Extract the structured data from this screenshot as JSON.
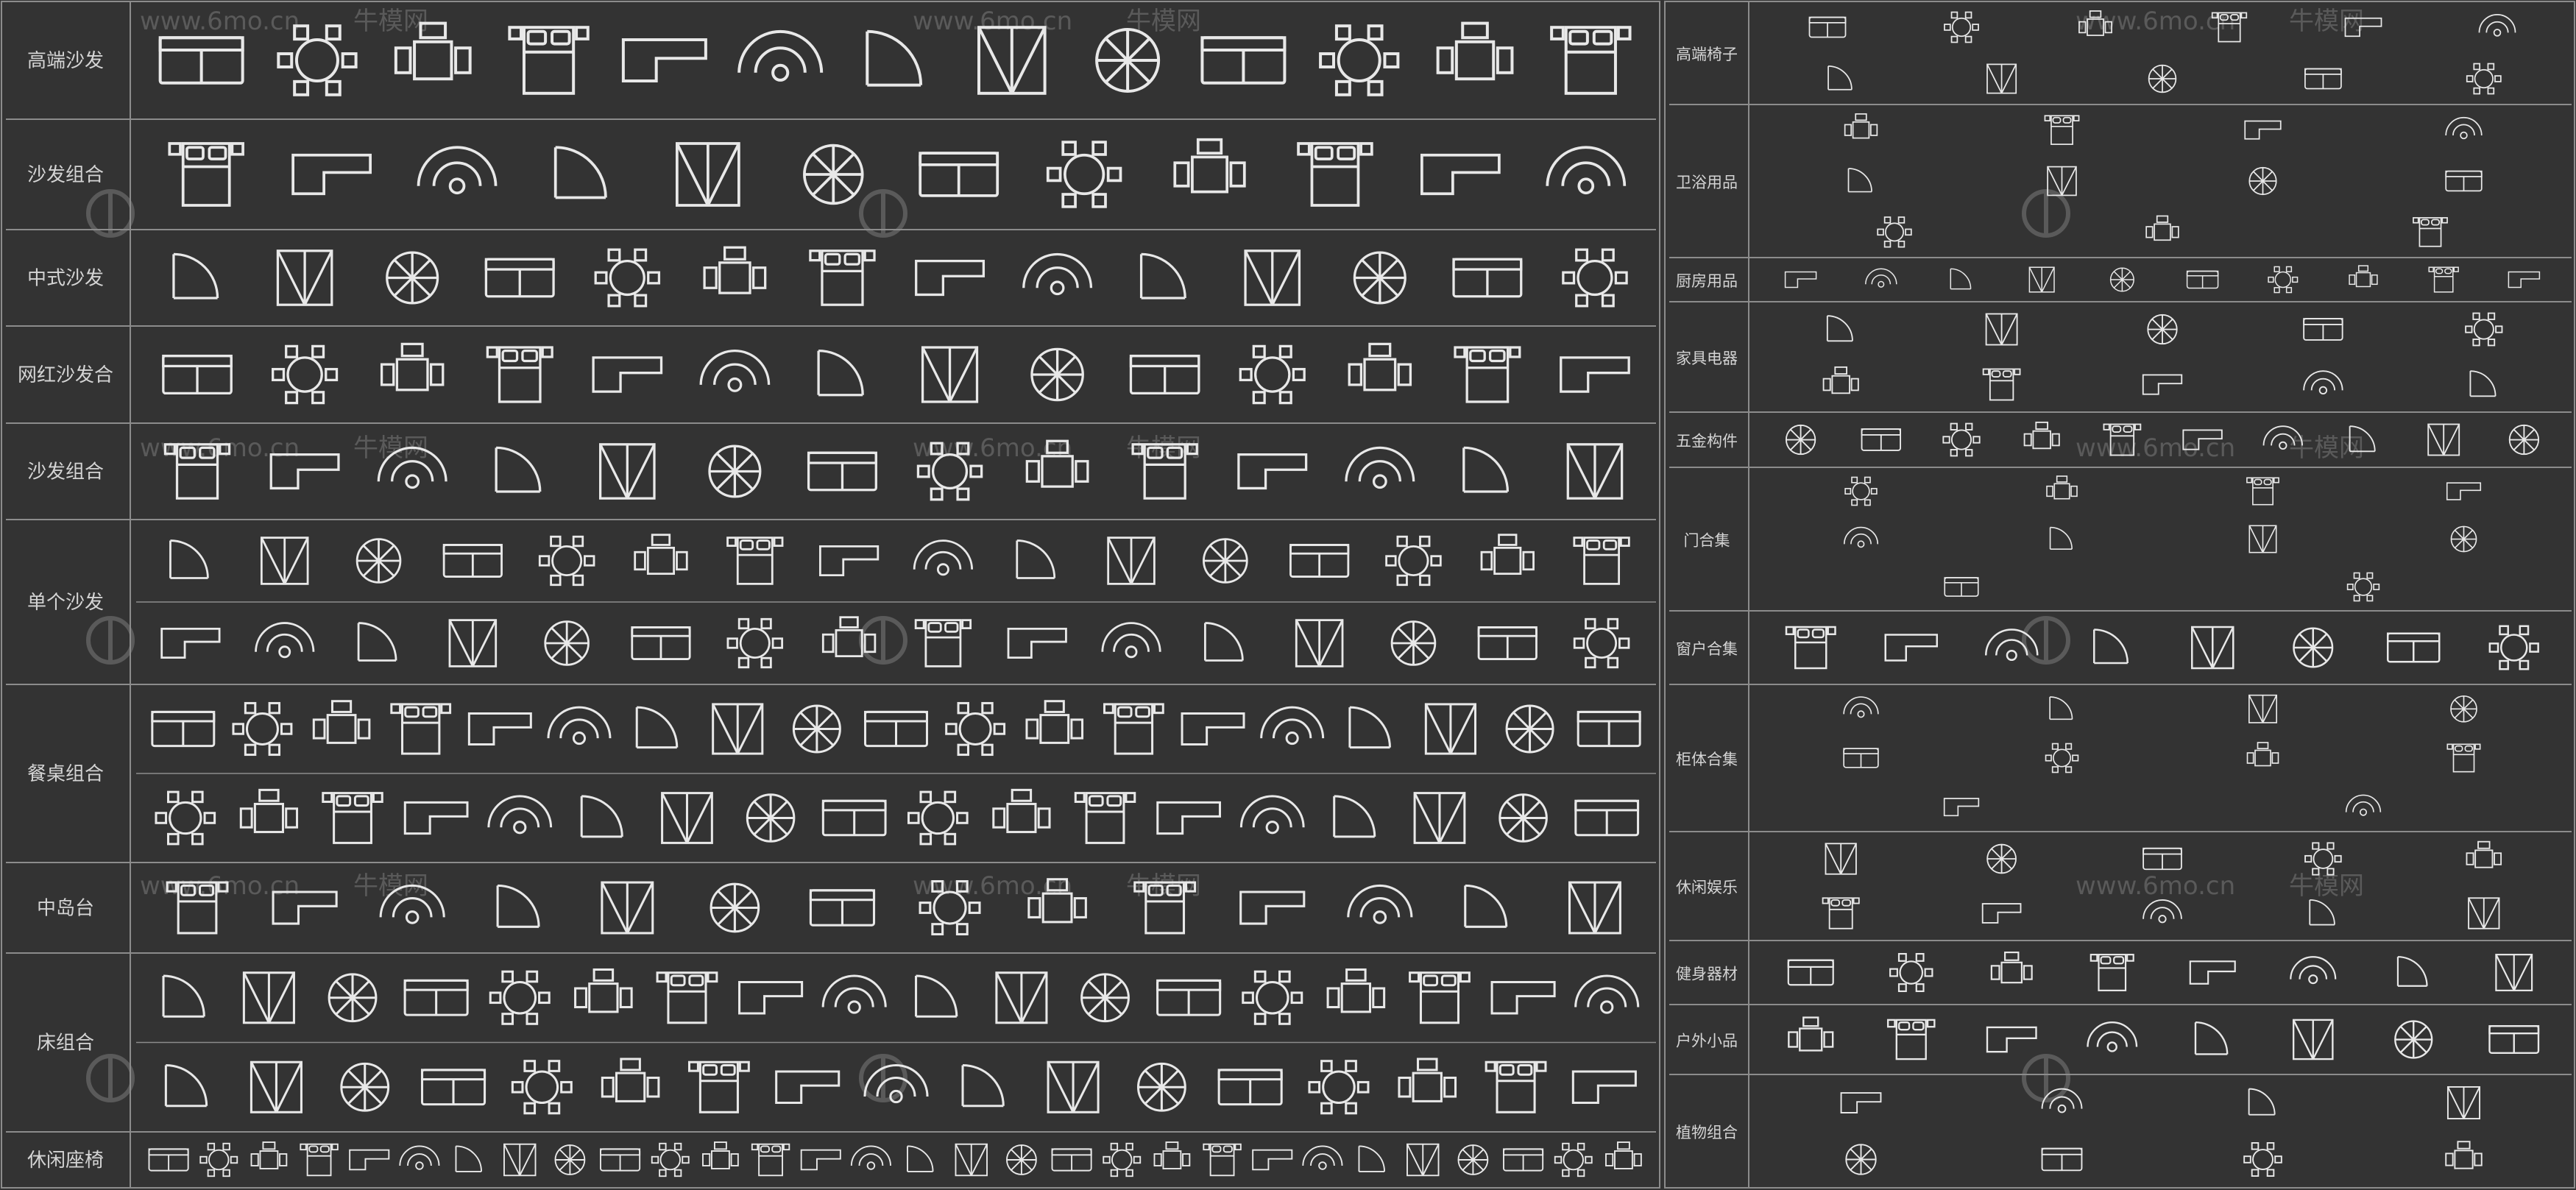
{
  "colors": {
    "background": "#333333",
    "grid": "#8c8c8c",
    "label": "#d4d4d4",
    "symbol": "#e8e8e8",
    "watermark": "#5a5a5a"
  },
  "watermark": {
    "site": "www.6mo.cn",
    "brand": "牛模网",
    "mark": "logo-circle-icon"
  },
  "left_panel": {
    "rows": [
      {
        "label": "高端沙发",
        "icons": [
          "round-sofa-set-icon",
          "lounge-group-icon",
          "armchair-set-icon",
          "round-table-sofa-icon",
          "circular-lounge-icon",
          "round-rug-sofa-icon",
          "curved-lounge-icon",
          "sofa-cluster-icon",
          "round-lounge-icon",
          "curved-sofa-icon",
          "round-table-set-icon",
          "lounge-rug-icon",
          "sofa-pair-icon"
        ]
      },
      {
        "label": "沙发组合",
        "icons": [
          "sofa-set-icon",
          "sectional-set-icon",
          "living-room-set-icon",
          "l-sofa-set-icon",
          "sofa-rug-set-icon",
          "angled-sofa-set-icon",
          "corner-sofa-set-icon",
          "sofa-table-set-icon",
          "diagonal-sofa-set-icon",
          "angled-living-set-icon",
          "sofa-group-icon",
          "curved-living-set-icon"
        ]
      },
      {
        "label": "中式沙发",
        "icons": [
          "chinese-sofa-icon",
          "chinese-sofa-set-icon",
          "rosewood-sofa-icon",
          "square-sofa-set-icon",
          "angled-chinese-sofa-icon",
          "carved-sofa-set-icon",
          "chinese-lounge-icon",
          "chinese-armchair-icon",
          "classical-sofa-icon",
          "chinese-couch-icon",
          "ming-sofa-icon",
          "qing-sofa-icon",
          "chinese-settee-icon",
          "chinese-bench-icon"
        ]
      },
      {
        "label": "网红沙发合",
        "icons": [
          "round-pouf-icon",
          "curved-sofa-icon",
          "s-curve-sofa-icon",
          "wave-sofa-icon",
          "round-seat-icon",
          "ring-sofa-icon",
          "modular-sofa-icon",
          "l-shape-sofa-icon",
          "low-sofa-icon",
          "sofa-bench-icon",
          "chaise-sofa-icon",
          "sofa-pod-icon",
          "arc-sofa-icon",
          "shell-seat-icon"
        ]
      },
      {
        "label": "沙发组合",
        "icons": [
          "sofa-combo-icon",
          "sofa-rug-icon",
          "sofa-table-icon",
          "sofa-lounge-icon",
          "sofa-carpet-icon",
          "oval-rug-sofa-icon",
          "rect-sofa-set-icon",
          "round-rug-set-icon",
          "sofa-square-icon",
          "couch-set-icon",
          "armchair-combo-icon",
          "sofa-suite-icon",
          "sofa-grouping-icon",
          "tv-sofa-set-icon"
        ]
      },
      {
        "label": "单个沙发",
        "icons": [
          "single-sofa-icon",
          "chaise-icon",
          "curved-couch-icon",
          "angled-couch-icon",
          "three-seat-sofa-icon",
          "l-sofa-icon",
          "boomerang-sofa-icon",
          "two-seat-sofa-icon",
          "loveseat-icon",
          "round-back-sofa-icon",
          "modular-couch-icon",
          "long-sofa-icon",
          "corner-sofa-icon",
          "sectional-sofa-icon",
          "u-sofa-icon",
          "curved-end-sofa-icon",
          "sofa-bed-icon",
          "chesterfield-icon",
          "day-bed-icon",
          "bench-sofa-icon",
          "side-sofa-icon",
          "tufted-sofa-icon",
          "compact-sofa-icon",
          "armless-sofa-icon",
          "corner-unit-icon",
          "modular-seat-icon",
          "recliner-icon",
          "accent-sofa-icon",
          "chair-pair-icon",
          "lounge-couch-icon",
          "bent-sofa-icon",
          "sofa-module-icon"
        ]
      },
      {
        "label": "餐桌组合",
        "icons": [
          "square-dining-icon",
          "star-dining-icon",
          "cross-dining-icon",
          "diamond-dining-icon",
          "round-four-icon",
          "round-six-icon",
          "round-eight-icon",
          "round-ten-icon",
          "round-twelve-icon",
          "round-slatted-icon",
          "round-chair-icon",
          "round-rings-icon",
          "round-star-icon",
          "oval-dining-icon",
          "rect-dining-icon",
          "long-dining-icon",
          "cafe-table-icon",
          "bar-dining-icon",
          "two-seat-table-icon",
          "plus-table-icon",
          "four-seat-table-icon",
          "cross-four-icon",
          "booth-table-icon",
          "square-two-icon",
          "bench-table-icon",
          "long-table-icon",
          "banquet-table-icon",
          "group-table-icon",
          "paired-tables-icon",
          "triple-tables-icon",
          "oval-banquet-icon",
          "round-cluster-icon",
          "small-oval-icon",
          "double-oval-icon",
          "small-round-icon",
          "oval-group-icon",
          "cross-small-icon"
        ]
      },
      {
        "label": "中岛台",
        "icons": [
          "island-counter-icon",
          "island-sink-icon",
          "kitchen-island-icon",
          "bar-counter-icon",
          "island-stools-icon",
          "long-island-icon",
          "island-bench-icon",
          "island-sink-stools-icon",
          "island-cooktop-icon",
          "island-seating-icon",
          "peninsula-icon",
          "island-table-icon",
          "kitchen-bar-icon",
          "island-round-icon"
        ]
      },
      {
        "label": "床组合",
        "icons": [
          "double-bed-icon",
          "bed-nightstands-icon",
          "queen-bed-icon",
          "king-bed-icon",
          "platform-bed-icon",
          "bed-set-icon",
          "single-bed-icon",
          "twin-bed-icon",
          "master-bed-icon",
          "round-bed-icon",
          "canopy-bed-icon",
          "upholstered-bed-icon",
          "bed-bench-icon",
          "storage-bed-icon",
          "plain-bed-icon",
          "hatched-bed-icon",
          "quilted-bed-icon",
          "textured-bed-icon",
          "patterned-bed-icon",
          "linen-bed-icon",
          "bed-rug-icon",
          "bed-carpet-icon",
          "bed-suite-icon",
          "bed-lamps-icon",
          "bed-pair-icon",
          "bedroom-set-icon",
          "bed-frame-icon",
          "bed-headboard-icon",
          "bed-throw-icon",
          "bed-group-icon",
          "hotel-bed-icon",
          "kids-bed-icon",
          "bed-combo-icon",
          "luxury-bed-icon",
          "bed-wide-icon"
        ]
      },
      {
        "label": "休闲座椅",
        "icons": [
          "bench-icon",
          "grid-bench-icon",
          "stool-icon",
          "leisure-chair-icon",
          "lounge-chair-icon",
          "chair-pair-icon",
          "armchair-icon",
          "small-chair-icon",
          "accent-chair-icon",
          "side-chair-icon",
          "club-chair-icon",
          "tub-chair-icon",
          "wing-chair-icon",
          "swivel-chair-icon",
          "pouf-icon",
          "ottoman-icon",
          "rocking-chair-icon",
          "egg-chair-icon",
          "barrel-chair-icon",
          "slipper-chair-icon",
          "chair-table-icon",
          "bistro-chair-icon",
          "round-stool-icon",
          "diamond-chair-icon",
          "hatched-chair-icon",
          "chair-group-icon",
          "cane-chair-icon",
          "lounge-seat-icon",
          "easy-chair-icon",
          "reading-chair-icon"
        ]
      }
    ]
  },
  "right_panel": {
    "rows": [
      {
        "label": "高端椅子",
        "icons": [
          "dining-chair-icon",
          "office-chair-icon",
          "arm-chair-icon",
          "bar-chair-icon",
          "lounge-chair-icon",
          "desk-chair-icon",
          "side-chair-icon",
          "folding-chair-icon",
          "stool-icon",
          "recliner-icon",
          "chaise-icon"
        ]
      },
      {
        "label": "卫浴用品",
        "icons": [
          "bathtub-icon",
          "toilet-icon",
          "washbasin-icon",
          "shower-icon",
          "urinal-icon",
          "vanity-icon",
          "bidet-icon",
          "towel-rack-icon",
          "mirror-icon",
          "faucet-icon",
          "drain-icon"
        ]
      },
      {
        "label": "厨房用品",
        "icons": [
          "stove-icon",
          "sink-icon",
          "fridge-icon",
          "oven-icon",
          "microwave-icon",
          "range-hood-icon",
          "dishwasher-icon",
          "cabinet-icon",
          "cookware-icon",
          "utensil-icon"
        ]
      },
      {
        "label": "家具电器",
        "icons": [
          "tv-icon",
          "speaker-icon",
          "washing-machine-icon",
          "fridge-icon",
          "air-conditioner-icon",
          "wardrobe-icon",
          "bookshelf-icon",
          "lamp-icon",
          "computer-icon",
          "piano-icon"
        ]
      },
      {
        "label": "五金构件",
        "icons": [
          "hinge-icon",
          "handle-icon",
          "lock-icon",
          "bracket-icon",
          "rail-icon",
          "bolt-icon",
          "knob-icon",
          "pull-icon",
          "latch-icon",
          "profile-icon"
        ]
      },
      {
        "label": "门合集",
        "icons": [
          "single-door-icon",
          "double-door-icon",
          "sliding-door-icon",
          "swing-door-icon",
          "folding-door-icon",
          "revolving-door-icon",
          "panel-door-icon",
          "glass-door-icon",
          "louvered-door-icon",
          "arched-door-icon"
        ]
      },
      {
        "label": "窗户合集",
        "icons": [
          "casement-window-icon",
          "sliding-window-icon",
          "fixed-window-icon",
          "bay-window-icon",
          "louver-window-icon",
          "curtain-icon",
          "awning-window-icon",
          "grid-window-icon"
        ]
      },
      {
        "label": "柜体合集",
        "icons": [
          "wardrobe-elevation-icon",
          "cabinet-elevation-icon",
          "shelf-unit-icon",
          "drawer-unit-icon",
          "display-cabinet-icon",
          "kitchen-cabinet-icon",
          "tv-cabinet-icon",
          "l-cabinet-icon",
          "glass-cabinet-icon",
          "hatched-cabinet-icon"
        ]
      },
      {
        "label": "休闲娱乐",
        "icons": [
          "billiard-table-icon",
          "piano-icon",
          "plant-icon",
          "car-icon",
          "motorcycle-icon",
          "ping-pong-icon",
          "game-table-icon",
          "mahjong-table-icon",
          "bicycle-icon",
          "sports-car-icon"
        ]
      },
      {
        "label": "健身器材",
        "icons": [
          "treadmill-icon",
          "dumbbell-icon",
          "exercise-bike-icon",
          "bench-press-icon",
          "rowing-machine-icon",
          "weight-rack-icon",
          "elliptical-icon",
          "yoga-mat-icon"
        ]
      },
      {
        "label": "户外小品",
        "icons": [
          "patio-set-icon",
          "umbrella-table-icon",
          "garden-bench-icon",
          "outdoor-chair-icon",
          "sun-lounger-icon",
          "parasol-icon",
          "bbq-grill-icon",
          "planter-icon"
        ]
      },
      {
        "label": "植物组合",
        "icons": [
          "tree-plan-icon",
          "shrub-icon",
          "flower-icon",
          "palm-icon",
          "tree-elevation-icon",
          "bush-icon",
          "hedge-icon",
          "potted-plant-icon"
        ]
      }
    ]
  }
}
